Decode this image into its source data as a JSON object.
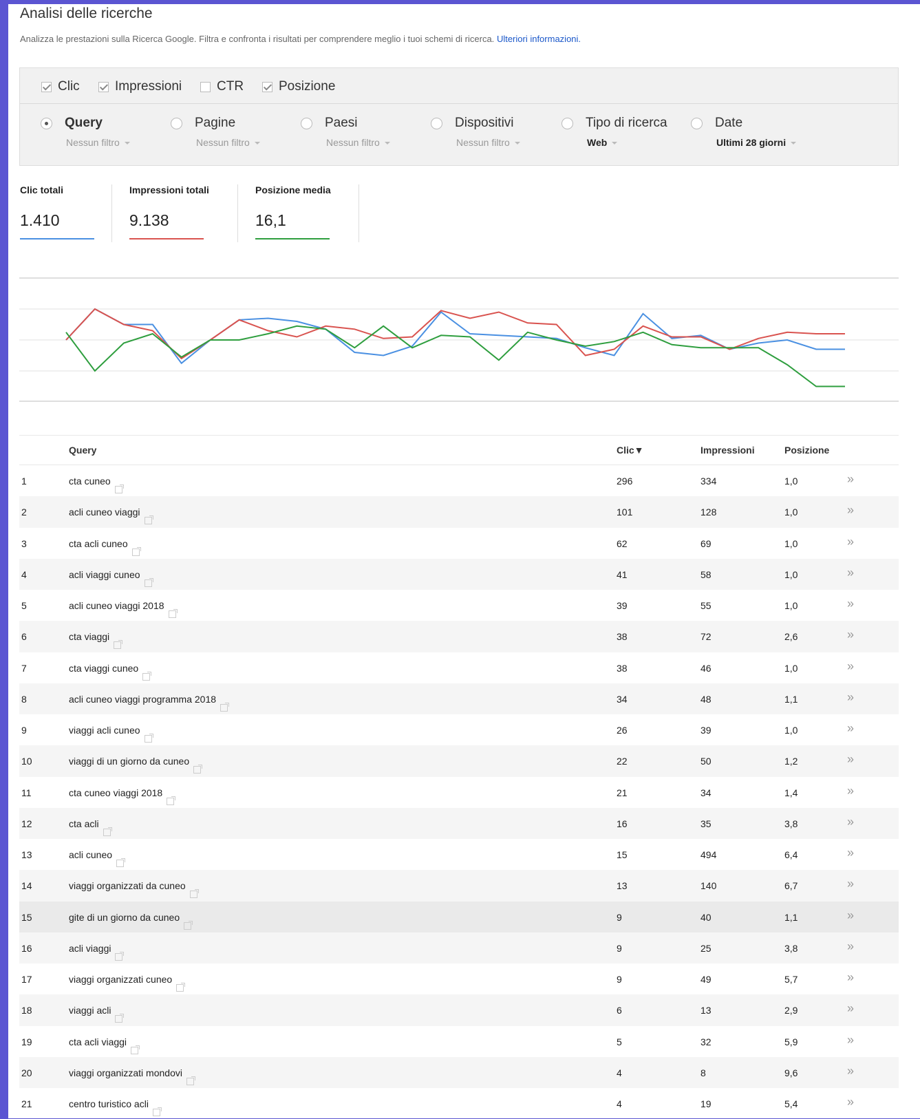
{
  "page": {
    "title": "Analisi delle ricerche",
    "description": "Analizza le prestazioni sulla Ricerca Google. Filtra e confronta i risultati per comprendere meglio i tuoi schemi di ricerca.",
    "learn_more": "Ulteriori informazioni."
  },
  "metrics": [
    {
      "label": "Clic",
      "checked": true
    },
    {
      "label": "Impressioni",
      "checked": true
    },
    {
      "label": "CTR",
      "checked": false
    },
    {
      "label": "Posizione",
      "checked": true
    }
  ],
  "dimensions": [
    {
      "label": "Query",
      "filter": "Nessun filtro",
      "selected": true
    },
    {
      "label": "Pagine",
      "filter": "Nessun filtro",
      "selected": false
    },
    {
      "label": "Paesi",
      "filter": "Nessun filtro",
      "selected": false
    },
    {
      "label": "Dispositivi",
      "filter": "Nessun filtro",
      "selected": false
    },
    {
      "label": "Tipo di ricerca",
      "filter": "Web",
      "selected": false
    },
    {
      "label": "Date",
      "filter": "Ultimi 28 giorni",
      "selected": false
    }
  ],
  "totals": [
    {
      "label": "Clic totali",
      "value": "1.410",
      "color": "#4a90e2"
    },
    {
      "label": "Impressioni totali",
      "value": "9.138",
      "color": "#d9534f"
    },
    {
      "label": "Posizione media",
      "value": "16,1",
      "color": "#2e9e3e"
    }
  ],
  "chart_data": {
    "type": "line",
    "title": "",
    "xlabel": "",
    "ylabel": "",
    "grid": true,
    "x": [
      1,
      2,
      3,
      4,
      5,
      6,
      7,
      8,
      9,
      10,
      11,
      12,
      13,
      14,
      15,
      16,
      17,
      18,
      19,
      20,
      21,
      22,
      23,
      24,
      25,
      26,
      27,
      28
    ],
    "series": [
      {
        "color": "#4a90e2",
        "values": [
          0.0,
          1.0,
          0.5,
          0.5,
          -0.75,
          0.0,
          0.65,
          0.7,
          0.6,
          0.35,
          -0.4,
          -0.5,
          -0.2,
          0.9,
          0.2,
          0.15,
          0.1,
          0.05,
          -0.25,
          -0.5,
          0.85,
          0.05,
          0.15,
          -0.3,
          -0.1,
          0.0,
          -0.3,
          -0.3
        ]
      },
      {
        "color": "#d9534f",
        "values": [
          0.0,
          1.0,
          0.5,
          0.3,
          -0.6,
          0.0,
          0.65,
          0.3,
          0.1,
          0.45,
          0.35,
          0.05,
          0.1,
          0.95,
          0.7,
          0.9,
          0.55,
          0.5,
          -0.5,
          -0.3,
          0.45,
          0.1,
          0.1,
          -0.3,
          0.05,
          0.25,
          0.2,
          0.2
        ]
      },
      {
        "color": "#2e9e3e",
        "values": [
          0.25,
          -1.0,
          -0.1,
          0.2,
          -0.55,
          0.0,
          0.0,
          0.2,
          0.45,
          0.35,
          -0.25,
          0.45,
          -0.25,
          0.15,
          0.1,
          -0.65,
          0.25,
          0.0,
          -0.2,
          -0.05,
          0.25,
          -0.15,
          -0.25,
          -0.25,
          -0.25,
          -0.8,
          -1.5,
          -1.5
        ]
      }
    ]
  },
  "table": {
    "headers": {
      "query": "Query",
      "clicks": "Clic▼",
      "impressions": "Impressioni",
      "position": "Posizione"
    },
    "rows": [
      {
        "n": "1",
        "q": "cta cuneo",
        "c": "296",
        "i": "334",
        "p": "1,0"
      },
      {
        "n": "2",
        "q": "acli cuneo viaggi",
        "c": "101",
        "i": "128",
        "p": "1,0"
      },
      {
        "n": "3",
        "q": "cta acli cuneo",
        "c": "62",
        "i": "69",
        "p": "1,0"
      },
      {
        "n": "4",
        "q": "acli viaggi cuneo",
        "c": "41",
        "i": "58",
        "p": "1,0"
      },
      {
        "n": "5",
        "q": "acli cuneo viaggi 2018",
        "c": "39",
        "i": "55",
        "p": "1,0"
      },
      {
        "n": "6",
        "q": "cta viaggi",
        "c": "38",
        "i": "72",
        "p": "2,6"
      },
      {
        "n": "7",
        "q": "cta viaggi cuneo",
        "c": "38",
        "i": "46",
        "p": "1,0"
      },
      {
        "n": "8",
        "q": "acli cuneo viaggi programma 2018",
        "c": "34",
        "i": "48",
        "p": "1,1"
      },
      {
        "n": "9",
        "q": "viaggi acli cuneo",
        "c": "26",
        "i": "39",
        "p": "1,0"
      },
      {
        "n": "10",
        "q": "viaggi di un giorno da cuneo",
        "c": "22",
        "i": "50",
        "p": "1,2"
      },
      {
        "n": "11",
        "q": "cta cuneo viaggi 2018",
        "c": "21",
        "i": "34",
        "p": "1,4"
      },
      {
        "n": "12",
        "q": "cta acli",
        "c": "16",
        "i": "35",
        "p": "3,8"
      },
      {
        "n": "13",
        "q": "acli cuneo",
        "c": "15",
        "i": "494",
        "p": "6,4"
      },
      {
        "n": "14",
        "q": "viaggi organizzati da cuneo",
        "c": "13",
        "i": "140",
        "p": "6,7"
      },
      {
        "n": "15",
        "q": "gite di un giorno da cuneo",
        "c": "9",
        "i": "40",
        "p": "1,1"
      },
      {
        "n": "16",
        "q": "acli viaggi",
        "c": "9",
        "i": "25",
        "p": "3,8"
      },
      {
        "n": "17",
        "q": "viaggi organizzati cuneo",
        "c": "9",
        "i": "49",
        "p": "5,7"
      },
      {
        "n": "18",
        "q": "viaggi acli",
        "c": "6",
        "i": "13",
        "p": "2,9"
      },
      {
        "n": "19",
        "q": "cta acli viaggi",
        "c": "5",
        "i": "32",
        "p": "5,9"
      },
      {
        "n": "20",
        "q": "viaggi organizzati mondovi",
        "c": "4",
        "i": "8",
        "p": "9,6"
      },
      {
        "n": "21",
        "q": "centro turistico acli",
        "c": "4",
        "i": "19",
        "p": "5,4"
      }
    ]
  }
}
